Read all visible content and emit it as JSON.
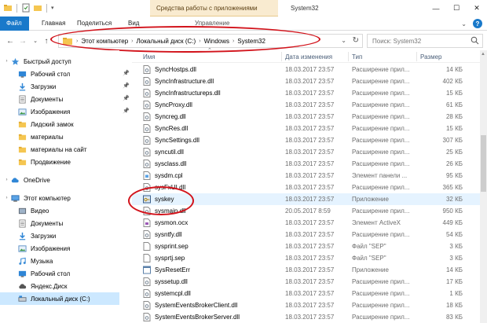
{
  "ribbon": {
    "tabs": [
      "Файл",
      "Главная",
      "Поделиться",
      "Вид",
      "Управление"
    ],
    "context_group": "Средства работы с приложениями"
  },
  "window": {
    "title": "System32"
  },
  "address": {
    "crumbs": [
      "Этот компьютер",
      "Локальный диск (C:)",
      "Windows",
      "System32"
    ],
    "search_placeholder": "Поиск: System32"
  },
  "sidebar": {
    "items": [
      {
        "label": "Быстрый доступ",
        "icon": "star-icon",
        "pinned": false
      },
      {
        "label": "Рабочий стол",
        "icon": "desktop-icon",
        "pinned": true
      },
      {
        "label": "Загрузки",
        "icon": "download-icon",
        "pinned": true
      },
      {
        "label": "Документы",
        "icon": "documents-icon",
        "pinned": true
      },
      {
        "label": "Изображения",
        "icon": "images-icon",
        "pinned": true
      },
      {
        "label": "Лидский замок",
        "icon": "folder-icon",
        "pinned": false
      },
      {
        "label": "материалы",
        "icon": "folder-icon",
        "pinned": false
      },
      {
        "label": "материалы на сайт",
        "icon": "folder-icon",
        "pinned": false
      },
      {
        "label": "Продвижение",
        "icon": "folder-icon",
        "pinned": false
      },
      {
        "label": "OneDrive",
        "icon": "cloud-icon",
        "pinned": false
      },
      {
        "label": "Этот компьютер",
        "icon": "computer-icon",
        "pinned": false
      },
      {
        "label": "Видео",
        "icon": "video-icon",
        "pinned": false
      },
      {
        "label": "Документы",
        "icon": "documents-icon",
        "pinned": false
      },
      {
        "label": "Загрузки",
        "icon": "download-icon",
        "pinned": false
      },
      {
        "label": "Изображения",
        "icon": "images-icon",
        "pinned": false
      },
      {
        "label": "Музыка",
        "icon": "music-icon",
        "pinned": false
      },
      {
        "label": "Рабочий стол",
        "icon": "desktop-icon",
        "pinned": false
      },
      {
        "label": "Яндекс.Диск",
        "icon": "yandex-disk-icon",
        "pinned": false
      },
      {
        "label": "Локальный диск (C:)",
        "icon": "drive-icon",
        "pinned": false
      }
    ]
  },
  "columns": {
    "name": "Имя",
    "date": "Дата изменения",
    "type": "Тип",
    "size": "Размер"
  },
  "files": [
    {
      "name": "SyncHostps.dll",
      "date": "18.03.2017 23:57",
      "type": "Расширение прил...",
      "size": "14 КБ",
      "icon": "dll-icon"
    },
    {
      "name": "SyncInfrastructure.dll",
      "date": "18.03.2017 23:57",
      "type": "Расширение прил...",
      "size": "402 КБ",
      "icon": "dll-icon"
    },
    {
      "name": "SyncInfrastructureps.dll",
      "date": "18.03.2017 23:57",
      "type": "Расширение прил...",
      "size": "15 КБ",
      "icon": "dll-icon"
    },
    {
      "name": "SyncProxy.dll",
      "date": "18.03.2017 23:57",
      "type": "Расширение прил...",
      "size": "61 КБ",
      "icon": "dll-icon"
    },
    {
      "name": "Syncreg.dll",
      "date": "18.03.2017 23:57",
      "type": "Расширение прил...",
      "size": "28 КБ",
      "icon": "dll-icon"
    },
    {
      "name": "SyncRes.dll",
      "date": "18.03.2017 23:57",
      "type": "Расширение прил...",
      "size": "15 КБ",
      "icon": "dll-icon"
    },
    {
      "name": "SyncSettings.dll",
      "date": "18.03.2017 23:57",
      "type": "Расширение прил...",
      "size": "307 КБ",
      "icon": "dll-icon"
    },
    {
      "name": "syncutil.dll",
      "date": "18.03.2017 23:57",
      "type": "Расширение прил...",
      "size": "25 КБ",
      "icon": "dll-icon"
    },
    {
      "name": "sysclass.dll",
      "date": "18.03.2017 23:57",
      "type": "Расширение прил...",
      "size": "26 КБ",
      "icon": "dll-icon"
    },
    {
      "name": "sysdm.cpl",
      "date": "18.03.2017 23:57",
      "type": "Элемент панели ...",
      "size": "95 КБ",
      "icon": "cpl-icon"
    },
    {
      "name": "sysFxUI.dll",
      "date": "18.03.2017 23:57",
      "type": "Расширение прил...",
      "size": "365 КБ",
      "icon": "dll-icon"
    },
    {
      "name": "syskey",
      "date": "18.03.2017 23:57",
      "type": "Приложение",
      "size": "32 КБ",
      "icon": "syskey-app-icon"
    },
    {
      "name": "sysmain.dll",
      "date": "20.05.2017 8:59",
      "type": "Расширение прил...",
      "size": "950 КБ",
      "icon": "dll-icon"
    },
    {
      "name": "sysmon.ocx",
      "date": "18.03.2017 23:57",
      "type": "Элемент ActiveX",
      "size": "449 КБ",
      "icon": "ocx-icon"
    },
    {
      "name": "sysntfy.dll",
      "date": "18.03.2017 23:57",
      "type": "Расширение прил...",
      "size": "54 КБ",
      "icon": "dll-icon"
    },
    {
      "name": "sysprint.sep",
      "date": "18.03.2017 23:57",
      "type": "Файл \"SEP\"",
      "size": "3 КБ",
      "icon": "file-icon"
    },
    {
      "name": "sysprtj.sep",
      "date": "18.03.2017 23:57",
      "type": "Файл \"SEP\"",
      "size": "3 КБ",
      "icon": "file-icon"
    },
    {
      "name": "SysResetErr",
      "date": "18.03.2017 23:57",
      "type": "Приложение",
      "size": "14 КБ",
      "icon": "app-icon"
    },
    {
      "name": "syssetup.dll",
      "date": "18.03.2017 23:57",
      "type": "Расширение прил...",
      "size": "17 КБ",
      "icon": "dll-icon"
    },
    {
      "name": "systemcpl.dll",
      "date": "18.03.2017 23:57",
      "type": "Расширение прил...",
      "size": "1 КБ",
      "icon": "dll-icon"
    },
    {
      "name": "SystemEventsBrokerClient.dll",
      "date": "18.03.2017 23:57",
      "type": "Расширение прил...",
      "size": "18 КБ",
      "icon": "dll-icon"
    },
    {
      "name": "SystemEventsBrokerServer.dll",
      "date": "18.03.2017 23:57",
      "type": "Расширение прил...",
      "size": "83 КБ",
      "icon": "dll-icon"
    }
  ],
  "colors": {
    "accent": "#1979ca",
    "annotation": "#d2131b",
    "selection": "#cce8ff",
    "context_tab": "#f9ebd0"
  }
}
